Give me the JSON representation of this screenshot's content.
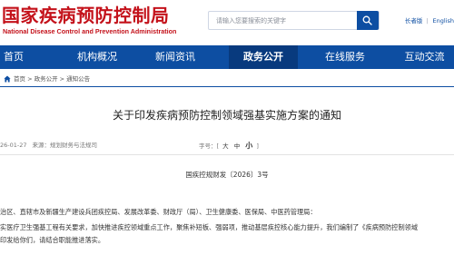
{
  "header": {
    "site_title": "国家疾病预防控制局",
    "site_subtitle": "National Disease Control and Prevention Administration",
    "search_placeholder": "请输入您要搜索的关键字",
    "links": [
      "长者版",
      "English"
    ]
  },
  "nav": {
    "items": [
      {
        "label": "首页"
      },
      {
        "label": "机构概况"
      },
      {
        "label": "新闻资讯"
      },
      {
        "label": "政务公开",
        "active": true
      },
      {
        "label": "在线服务"
      },
      {
        "label": "互动交流"
      }
    ]
  },
  "breadcrumb": "首页 > 政务公开 > 通知公告",
  "article": {
    "title": "关于印发疾病预防控制领域强基实施方案的通知",
    "date": "26-01-27",
    "source": "来源：规划财务与法规司",
    "font_size": {
      "prefix": "字号：[",
      "options": [
        "大",
        "中",
        "小"
      ],
      "suffix": "]"
    },
    "doc_number": "国疾控规财发〔2026〕3号",
    "addressee": "治区、直辖市及新疆生产建设兵团疾控局、发展改革委、财政厅（局）、卫生健康委、医保局、中医药管理局：",
    "para_1": "实医疗卫生强基工程有关要求，加快推进疾控领域重点工作，聚焦补短板、强弱项，推动基层疾控核心能力提升，我们编制了《疾病预防控制领域",
    "para_2": "印发给你们，请结合职能推进落实。"
  },
  "colors": {
    "brand_red": "#c4121b",
    "nav_blue": "#0d4ea2",
    "nav_active": "#083a7e"
  }
}
